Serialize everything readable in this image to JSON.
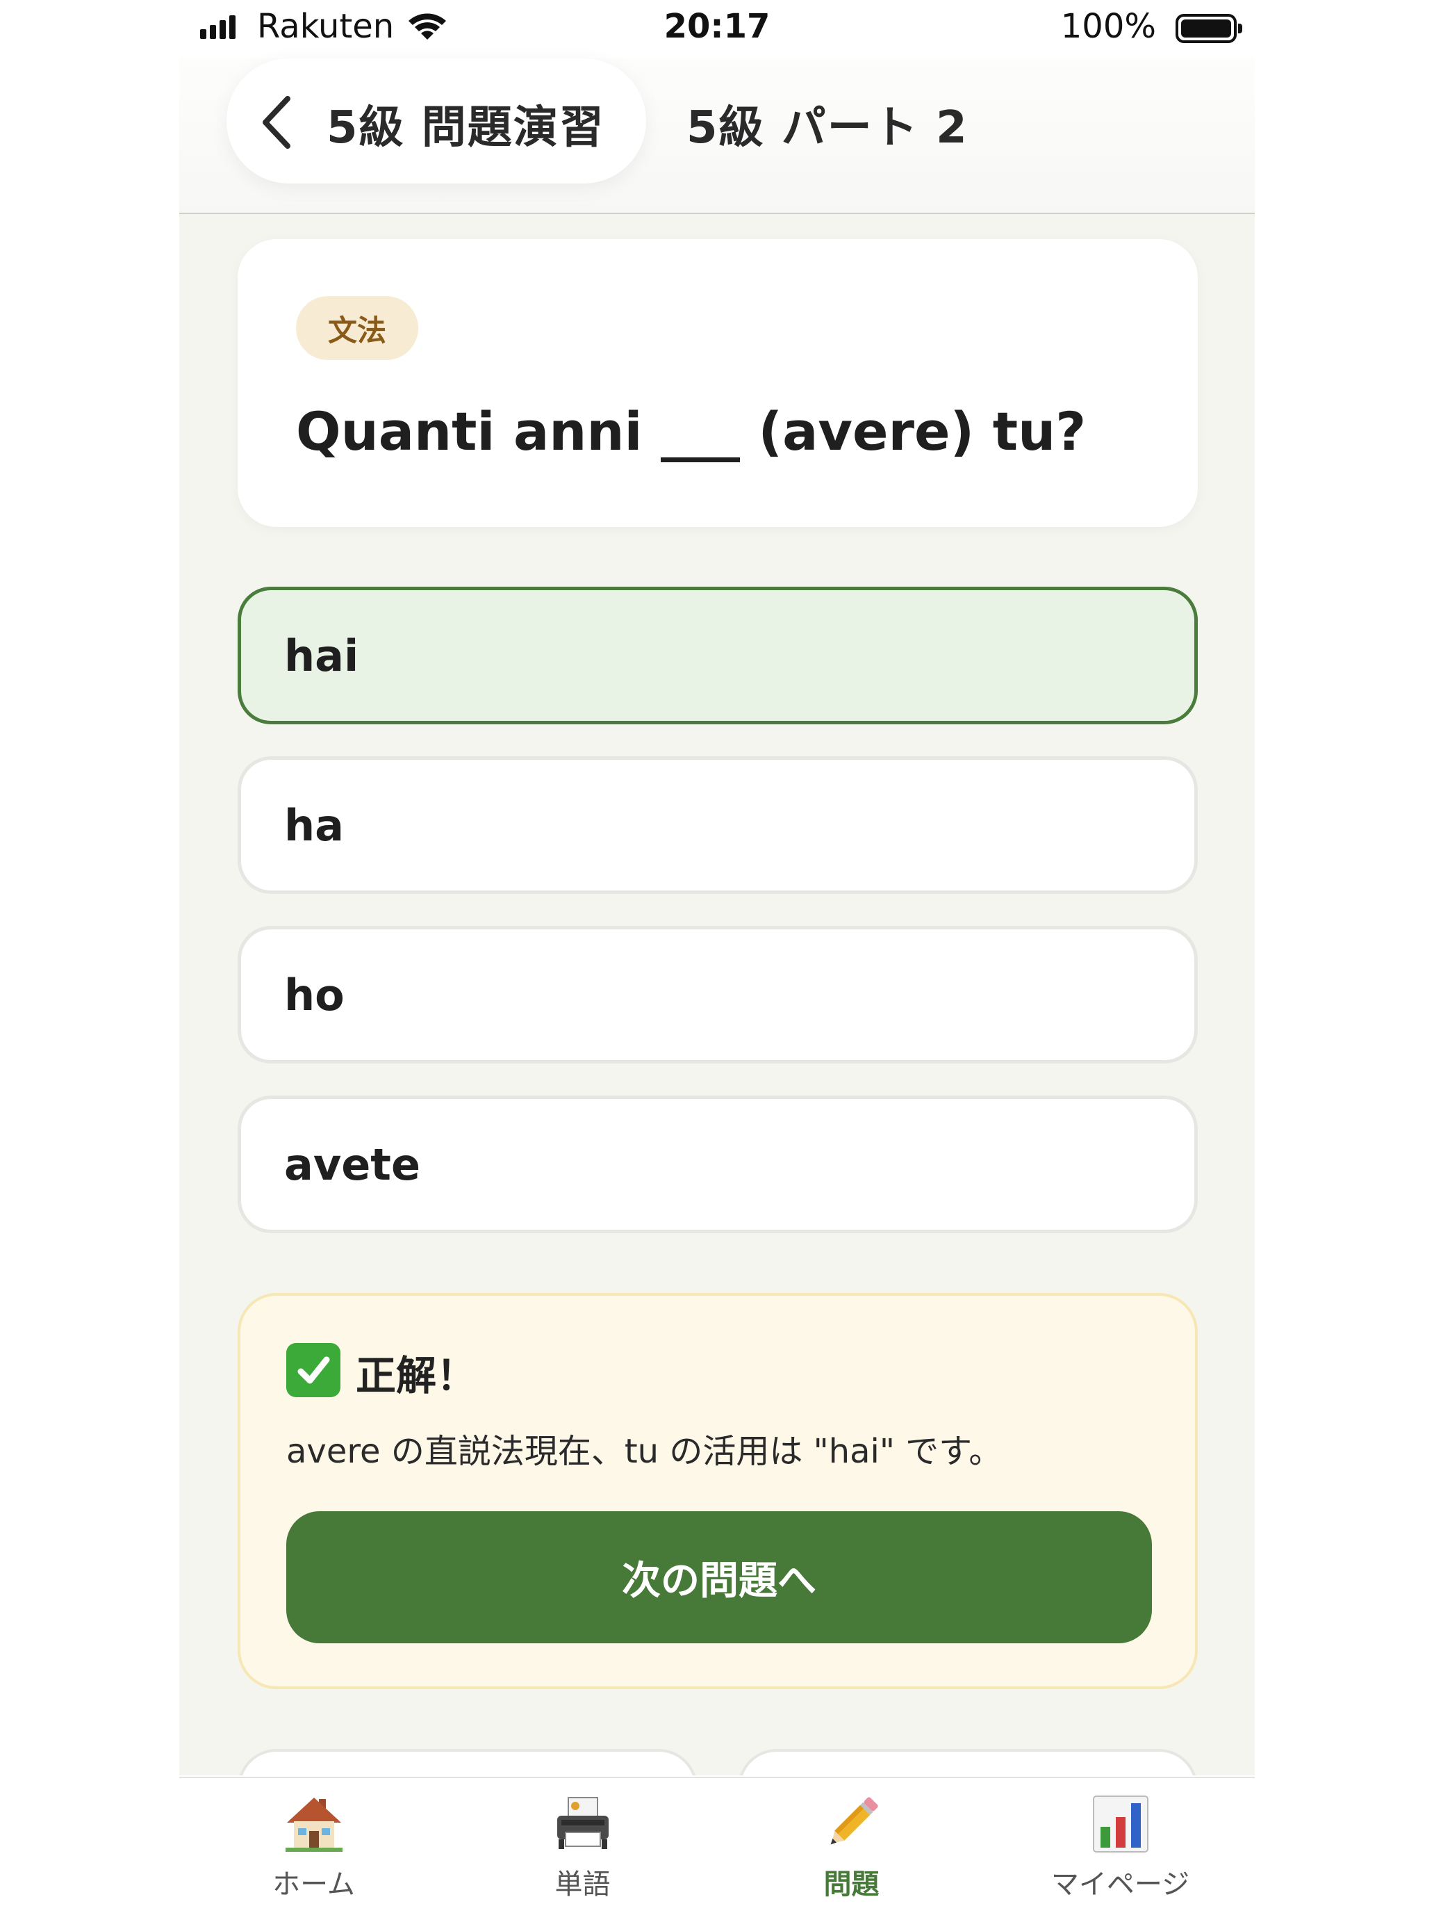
{
  "status_bar": {
    "carrier": "Rakuten",
    "time": "20:17",
    "battery": "100%"
  },
  "nav": {
    "back_label": "5級 問題演習",
    "title": "5級 パート 2"
  },
  "question": {
    "category": "文法",
    "text": "Quanti anni ___ (avere) tu?"
  },
  "options": [
    {
      "label": "hai",
      "state": "correct"
    },
    {
      "label": "ha",
      "state": "default"
    },
    {
      "label": "ho",
      "state": "default"
    },
    {
      "label": "avete",
      "state": "default"
    }
  ],
  "feedback": {
    "title": "正解！",
    "explanation": "avere の直説法現在、tu の活用は \"hai\" です。",
    "next_label": "次の問題へ"
  },
  "tabs": [
    {
      "label": "ホーム",
      "icon": "house-icon"
    },
    {
      "label": "単語",
      "icon": "printer-icon"
    },
    {
      "label": "問題",
      "icon": "pencil-icon",
      "active": true
    },
    {
      "label": "マイページ",
      "icon": "bar-chart-icon"
    }
  ],
  "colors": {
    "accent": "#477a39",
    "correct_bg": "#e8f3e6",
    "feedback_bg": "#fdf8e8",
    "content_bg": "#f5f5f0"
  }
}
